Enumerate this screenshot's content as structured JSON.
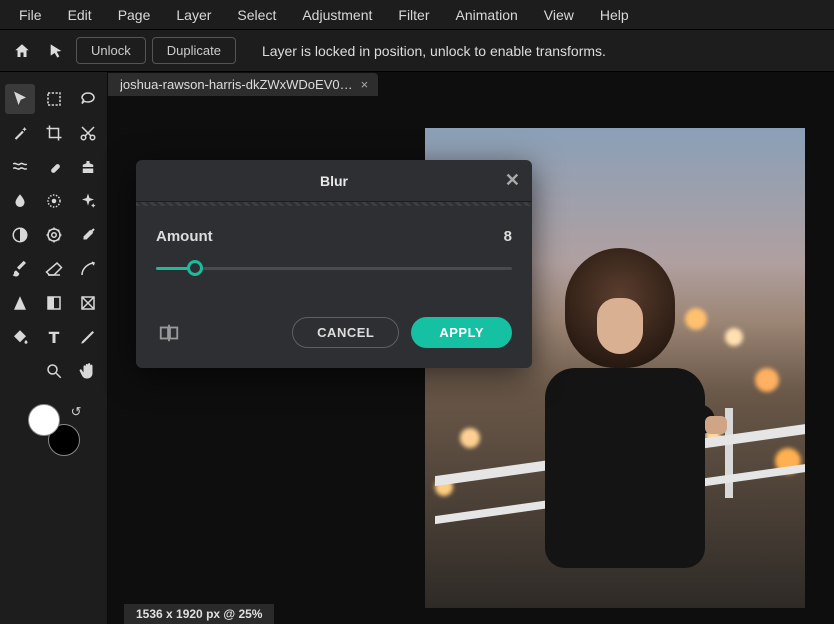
{
  "menus": [
    "File",
    "Edit",
    "Page",
    "Layer",
    "Select",
    "Adjustment",
    "Filter",
    "Animation",
    "View",
    "Help"
  ],
  "toolbar": {
    "unlock_label": "Unlock",
    "duplicate_label": "Duplicate",
    "status": "Layer is locked in position, unlock to enable transforms."
  },
  "tab": {
    "name": "joshua-rawson-harris-dkZWxWDoEV0…",
    "close": "×"
  },
  "dialog": {
    "title": "Blur",
    "amount_label": "Amount",
    "amount_value": "8",
    "cancel": "CANCEL",
    "apply": "APPLY"
  },
  "status": "1536 x 1920 px @ 25%",
  "colors": {
    "accent": "#16c0a3",
    "fg": "#ffffff",
    "bg": "#000000"
  },
  "tools": [
    "arrow-select",
    "marquee-select",
    "lasso-select",
    "magic-wand",
    "crop",
    "cut",
    "liquify",
    "heal",
    "clone-stamp",
    "blur-drop",
    "pixelate",
    "sparkle",
    "contrast-circle",
    "gear-adjust",
    "eyedropper",
    "brush",
    "eraser",
    "pen-curve",
    "sharpen-triangle",
    "gradient",
    "frame",
    "fill-bucket",
    "text",
    "pen",
    "zoom",
    "hand"
  ]
}
